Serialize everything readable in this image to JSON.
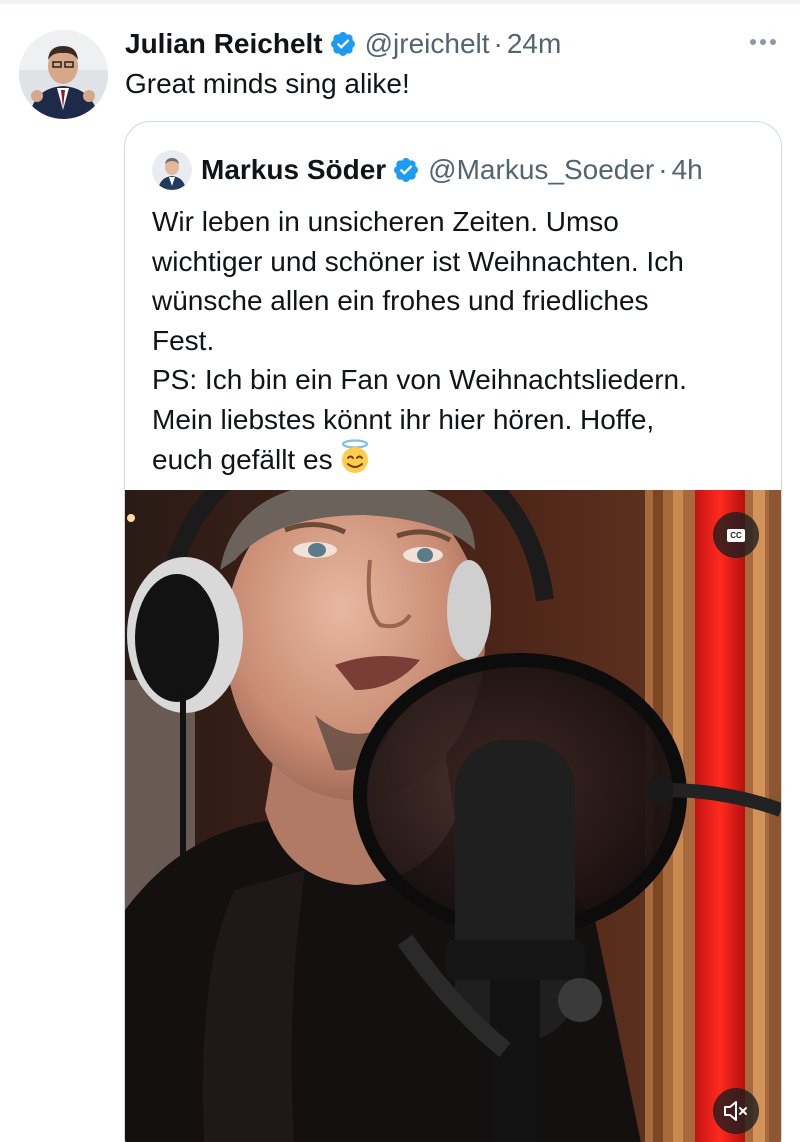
{
  "tweet": {
    "author_name": "Julian Reichelt",
    "handle": "@jreichelt",
    "separator": "·",
    "time": "24m",
    "text": "Great minds sing alike!",
    "verified": true
  },
  "quoted_tweet": {
    "author_name": "Markus Söder",
    "handle": "@Markus_Soeder",
    "separator": "·",
    "time": "4h",
    "verified": true,
    "text_lines": [
      "Wir leben in unsicheren Zeiten. Umso",
      "wichtiger und schöner ist Weihnachten. Ich",
      "wünsche allen ein frohes und friedliches",
      "Fest.",
      "PS: Ich bin ein Fan von Weihnachtsliedern.",
      "Mein liebstes könnt ihr hier hören. Hoffe,",
      "euch gefällt es"
    ],
    "emoji": "smiling-face-with-halo-emoji",
    "media": {
      "type": "video",
      "captions_label": "CC",
      "controls": [
        "captions-button",
        "mute-button"
      ]
    }
  },
  "colors": {
    "text_primary": "#0f1419",
    "text_secondary": "#536471",
    "verified_blue": "#1d9bf0",
    "border": "#cfd9de"
  },
  "icons": {
    "verified": "verified-badge-icon",
    "more": "more-dots-icon",
    "captions": "cc-icon",
    "mute": "speaker-muted-icon"
  }
}
